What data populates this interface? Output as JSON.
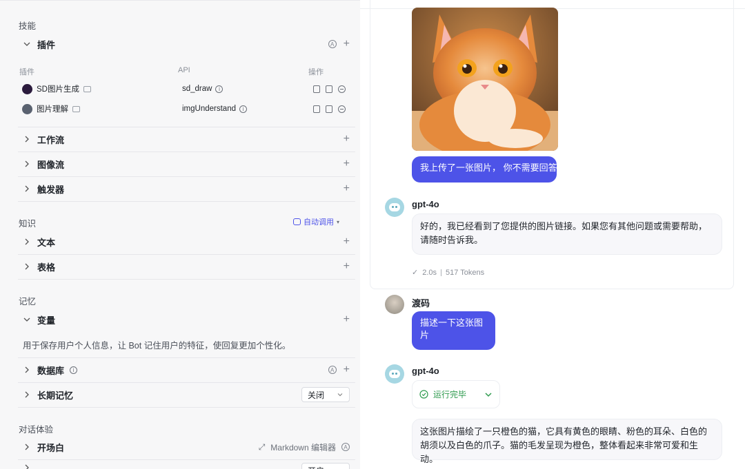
{
  "left": {
    "skills_title": "技能",
    "plugin_section": "插件",
    "table_headers": {
      "plugin": "插件",
      "api": "API",
      "ops": "操作"
    },
    "plugins": [
      {
        "name": "SD图片生成",
        "api": "sd_draw",
        "avatar_color": "#2b1b3d"
      },
      {
        "name": "图片理解",
        "api": "imgUnderstand",
        "avatar_color": "#5a6270"
      }
    ],
    "workflow": "工作流",
    "imageflow": "图像流",
    "trigger": "触发器",
    "knowledge_title": "知识",
    "auto_call": "自动调用",
    "text": "文本",
    "table": "表格",
    "memory_title": "记忆",
    "variables": "变量",
    "variables_desc": "用于保存用户个人信息，让 Bot 记住用户的特征，使回复更加个性化。",
    "database": "数据库",
    "long_memory": "长期记忆",
    "long_memory_value": "关闭",
    "dialog_title": "对话体验",
    "opening": "开场白",
    "markdown_editor": "Markdown 编辑器",
    "cut_row_value": "开启"
  },
  "chat": {
    "user_msg_1": "我上传了一张图片， 你不需要回答",
    "bot_name": "gpt-4o",
    "bot_reply_1": "好的，我已经看到了您提供的图片链接。如果您有其他问题或需要帮助，请随时告诉我。",
    "time": "2.0s",
    "tokens": "517 Tokens",
    "user_name": "渡码",
    "user_msg_2": "描述一下这张图片",
    "run_status": "运行完毕",
    "bot_reply_2": "这张图片描绘了一只橙色的猫，它具有黄色的眼睛、粉色的耳朵、白色的胡须以及白色的爪子。猫的毛发呈现为橙色，整体看起来非常可爱和生动。"
  },
  "colors": {
    "accent": "#4d53e8",
    "success": "#2e9b4e"
  }
}
